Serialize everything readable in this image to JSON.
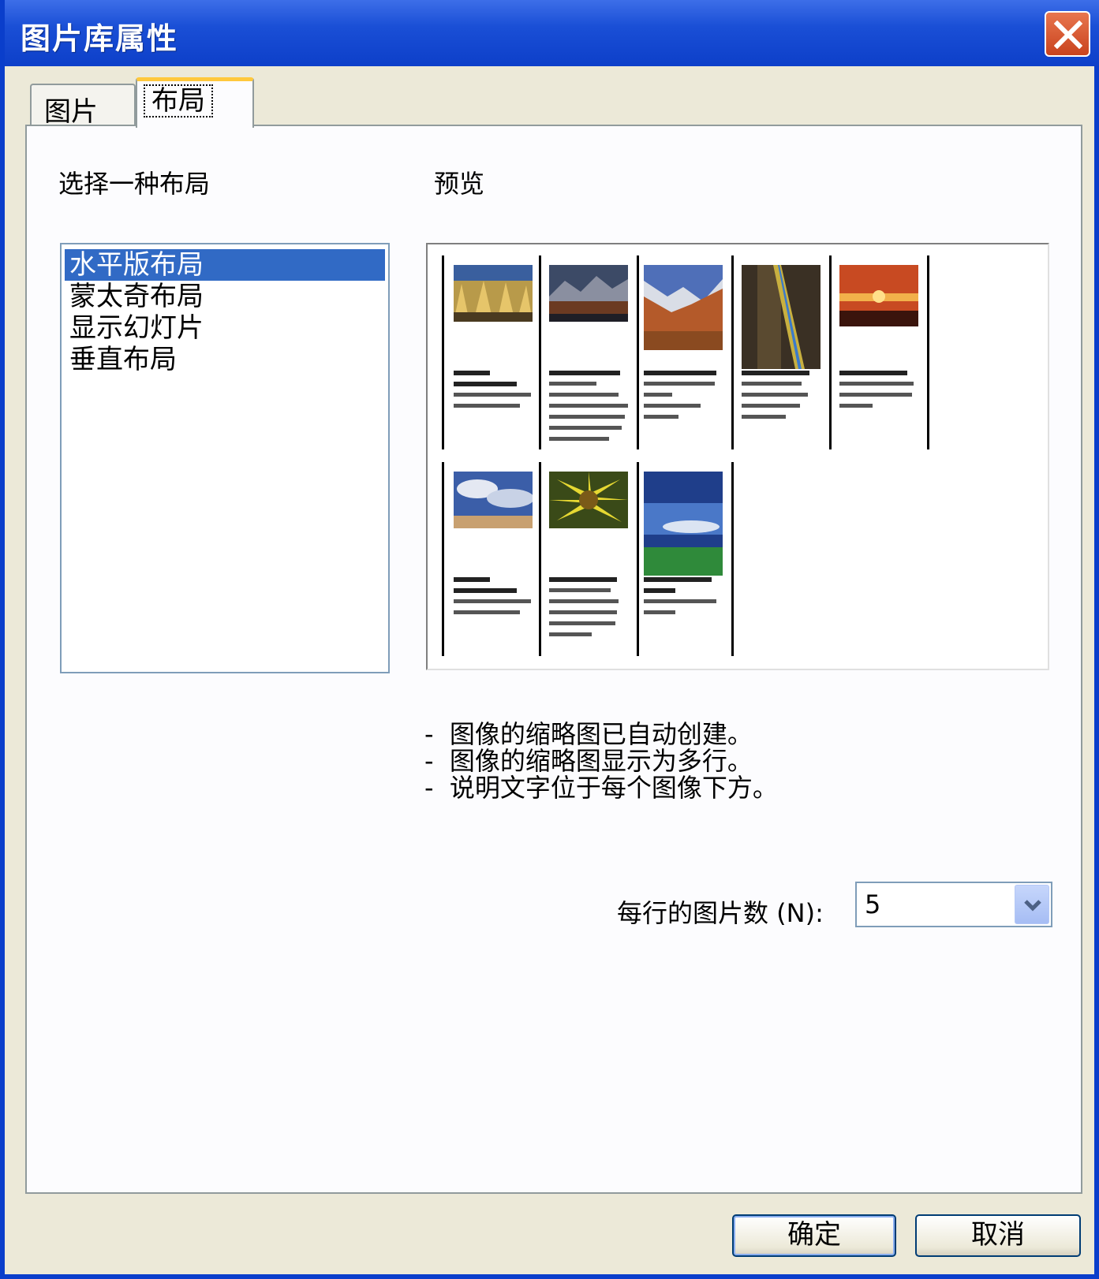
{
  "window": {
    "title": "图片库属性"
  },
  "tabs": [
    {
      "label": "图片",
      "active": false
    },
    {
      "label": "布局",
      "active": true
    }
  ],
  "layout_section": {
    "label": "选择一种布局"
  },
  "layouts": [
    {
      "label": "水平版布局",
      "selected": true
    },
    {
      "label": "蒙太奇布局",
      "selected": false
    },
    {
      "label": "显示幻灯片",
      "selected": false
    },
    {
      "label": "垂直布局",
      "selected": false
    }
  ],
  "preview_section": {
    "label": "预览"
  },
  "description": [
    "-  图像的缩略图已自动创建。",
    "-  图像的缩略图显示为多行。",
    "-  说明文字位于每个图像下方。"
  ],
  "pictures_per_row": {
    "label": "每行的图片数 (N):",
    "value": "5"
  },
  "buttons": {
    "ok": "确定",
    "cancel": "取消"
  },
  "colors": {
    "title_bar": "#0d3fc9",
    "selection": "#316ac5",
    "tab_accent": "#ffc83c"
  }
}
